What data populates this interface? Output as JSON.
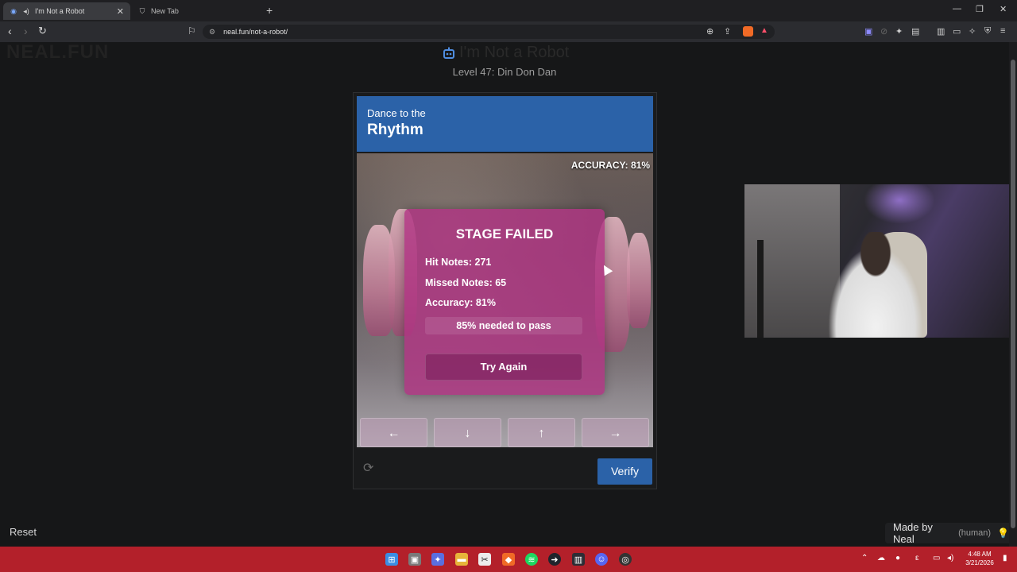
{
  "browser": {
    "tabs": [
      {
        "title": "I'm Not a Robot",
        "active": true,
        "icon": "robot-icon"
      },
      {
        "title": "New Tab",
        "active": false,
        "icon": "brave-shield-icon"
      }
    ],
    "url": "neal.fun/not-a-robot/",
    "new_tab_label": "+"
  },
  "page": {
    "logo": "NEAL.FUN",
    "site_title": "I'm Not a Robot",
    "level": "Level 47: Din Don Dan"
  },
  "captcha": {
    "header_small": "Dance to the",
    "header_big": "Rhythm",
    "accuracy_display": "ACCURACY: 81%",
    "result": {
      "title": "STAGE FAILED",
      "hit_notes": "Hit Notes: 271",
      "missed_notes": "Missed Notes: 65",
      "accuracy": "Accuracy: 81%",
      "needed": "85% needed to pass",
      "retry_label": "Try Again"
    },
    "arrows": [
      "←",
      "↓",
      "↑",
      "→"
    ],
    "verify_label": "Verify",
    "refresh_icon": "⟳"
  },
  "footer": {
    "reset_label": "Reset",
    "made_by": "Made by Neal",
    "human": "(human)"
  },
  "taskbar": {
    "time": "4:48 AM",
    "date": "3/21/2026"
  },
  "colors": {
    "header_blue": "#2b62a8",
    "fail_pink": "#b03482",
    "taskbar_red": "#b3202a"
  }
}
